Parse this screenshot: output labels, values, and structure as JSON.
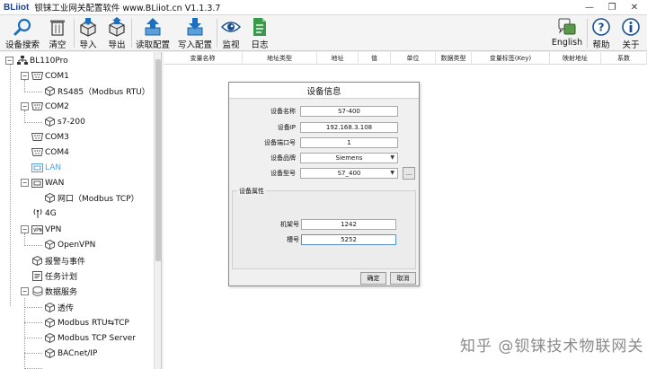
{
  "app": {
    "logo": "BLiiot",
    "title": "钡铼工业网关配置软件 www.BLiiot.cn V1.1.3.7",
    "min_glyph": "—",
    "restore_glyph": "❐",
    "close_glyph": "✕"
  },
  "toolbar": {
    "search": "设备搜索",
    "clear": "清空",
    "import": "导入",
    "export": "导出",
    "read_config": "读取配置",
    "write_config": "写入配置",
    "monitor": "监视",
    "log": "日志",
    "english": "English",
    "help": "帮助",
    "about": "关于"
  },
  "tree": {
    "root": "BL110Pro",
    "com1": "COM1",
    "com1_child": "RS485（Modbus RTU）",
    "com2": "COM2",
    "com2_child": "s7-200",
    "com3": "COM3",
    "com4": "COM4",
    "lan": "LAN",
    "wan": "WAN",
    "wan_child": "网口（Modbus TCP）",
    "g4": "4G",
    "vpn": "VPN",
    "vpn_child": "OpenVPN",
    "alarm": "报警与事件",
    "task": "任务计划",
    "data_service": "数据服务",
    "ds_passthrough": "透传",
    "ds_rtu_tcp": "Modbus RTU⇆TCP",
    "ds_tcp_server": "Modbus TCP Server",
    "ds_bacnet": "BACnet/IP",
    "collapse": "−",
    "expand": "+",
    "icon_lan_color": "#5aa0d8"
  },
  "table": {
    "columns": [
      "变量名称",
      "地址类型",
      "地址",
      "值",
      "单位",
      "数据类型",
      "变量标签(Key)",
      "映射地址",
      "系数"
    ]
  },
  "dialog": {
    "title": "设备信息",
    "fields": {
      "device_name_label": "设备名称",
      "device_name_value": "S7-400",
      "device_ip_label": "设备IP",
      "device_ip_value": "192.168.3.108",
      "device_port_label": "设备端口号",
      "device_port_value": "1",
      "brand_label": "设备品牌",
      "brand_value": "Siemens",
      "model_label": "设备型号",
      "model_value": "S7_400"
    },
    "browse_label": "...",
    "group_title": "设备属性",
    "props": {
      "rack_label": "机架号",
      "rack_value": "1242",
      "slot_label": "槽号",
      "slot_value": "5252"
    },
    "ok": "确定",
    "cancel": "取消"
  },
  "watermark": "知乎 @钡铼技术物联网关"
}
